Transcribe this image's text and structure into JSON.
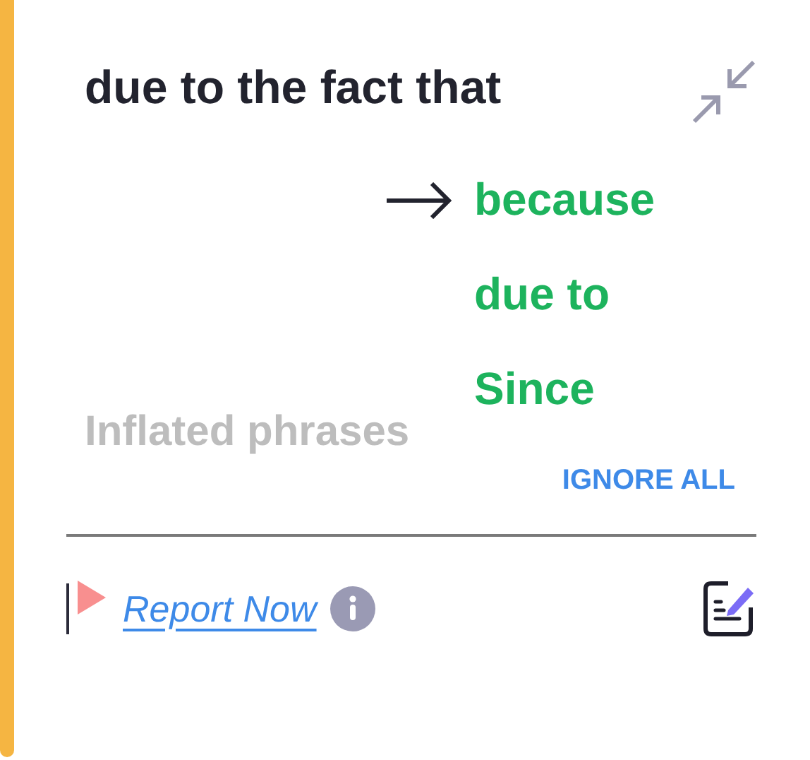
{
  "phrase": "due to the fact that",
  "suggestions": [
    {
      "text": "because",
      "selected": true
    },
    {
      "text": "due to",
      "selected": false
    },
    {
      "text": "Since",
      "selected": false
    }
  ],
  "category": "Inflated phrases",
  "ignore_button": "IGNORE ALL",
  "report_link": "Report Now"
}
